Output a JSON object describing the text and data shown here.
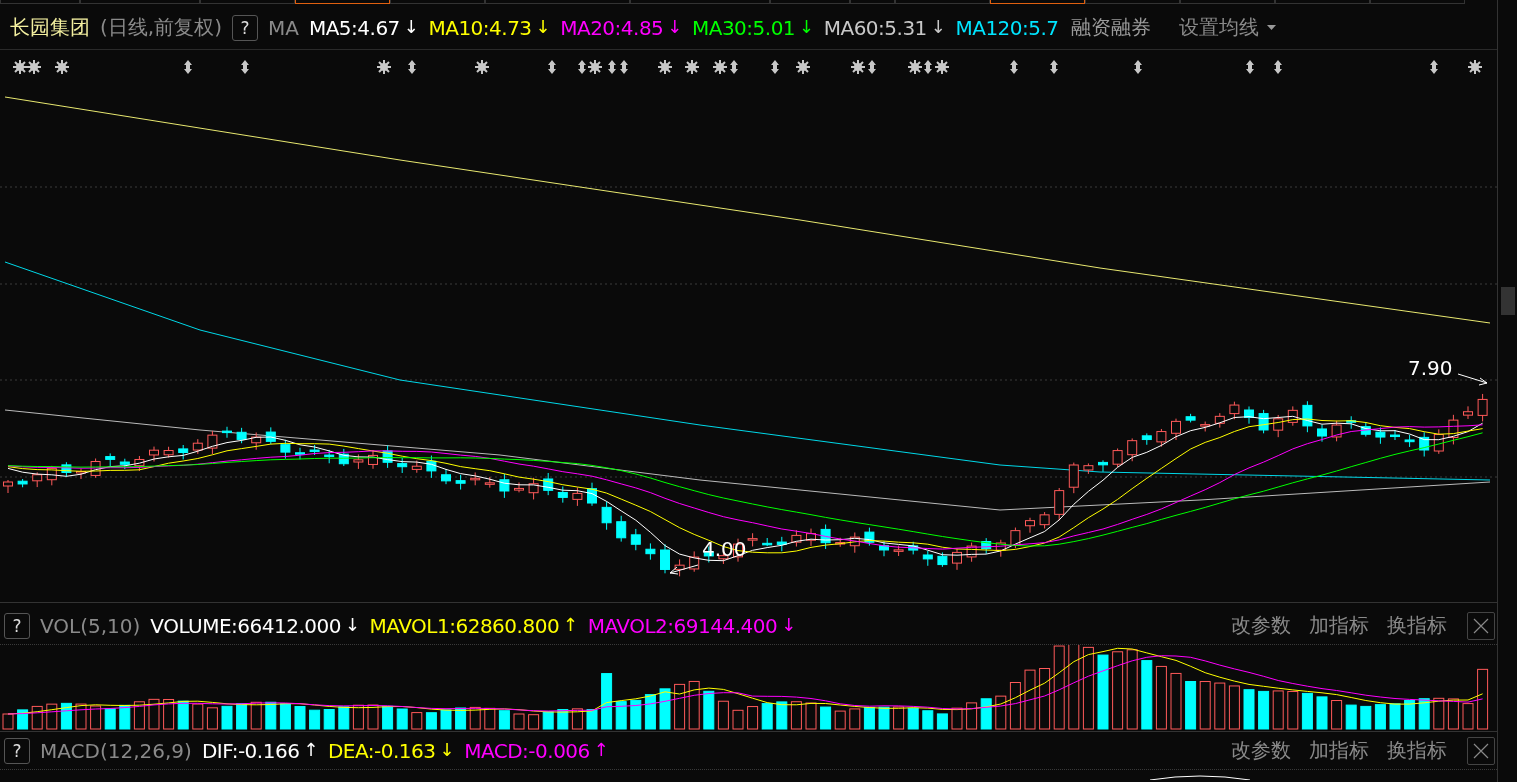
{
  "header": {
    "stock_name": "长园集团",
    "period": "(日线,前复权)",
    "help_button": "?",
    "indicator": "MA",
    "readings": [
      {
        "label": "MA5:4.67",
        "arrow": "↓",
        "color": "#ffffff"
      },
      {
        "label": "MA10:4.73",
        "arrow": "↓",
        "color": "#ffff00"
      },
      {
        "label": "MA20:4.85",
        "arrow": "↓",
        "color": "#ff00ff"
      },
      {
        "label": "MA30:5.01",
        "arrow": "↓",
        "color": "#00ff00"
      },
      {
        "label": "MA60:5.31",
        "arrow": "↓",
        "color": "#c8c8c8"
      },
      {
        "label": "MA120:5.7",
        "color": "#00e5ff"
      }
    ],
    "margin_trading": "融资融券",
    "ma_settings": "设置均线"
  },
  "price_chart": {
    "high_label": "7.90",
    "low_label": "4.00"
  },
  "panels": [
    {
      "kind": "volume",
      "help_button": "?",
      "name": "VOL(5,10)",
      "readings": [
        {
          "label": "VOLUME:66412.000",
          "arrow": "↓",
          "color": "#ffffff"
        },
        {
          "label": "MAVOL1:62860.800",
          "arrow": "↑",
          "color": "#ffff00"
        },
        {
          "label": "MAVOL2:69144.400",
          "arrow": "↓",
          "color": "#ff00ff"
        }
      ],
      "actions": [
        "改参数",
        "加指标",
        "换指标"
      ]
    },
    {
      "kind": "macd",
      "help_button": "?",
      "name": "MACD(12,26,9)",
      "readings": [
        {
          "label": "DIF:-0.166",
          "arrow": "↑",
          "color": "#ffffff"
        },
        {
          "label": "DEA:-0.163",
          "arrow": "↓",
          "color": "#ffff00"
        },
        {
          "label": "MACD:-0.006",
          "arrow": "↑",
          "color": "#ff00ff"
        }
      ],
      "actions": [
        "改参数",
        "加指标",
        "换指标"
      ]
    }
  ]
}
